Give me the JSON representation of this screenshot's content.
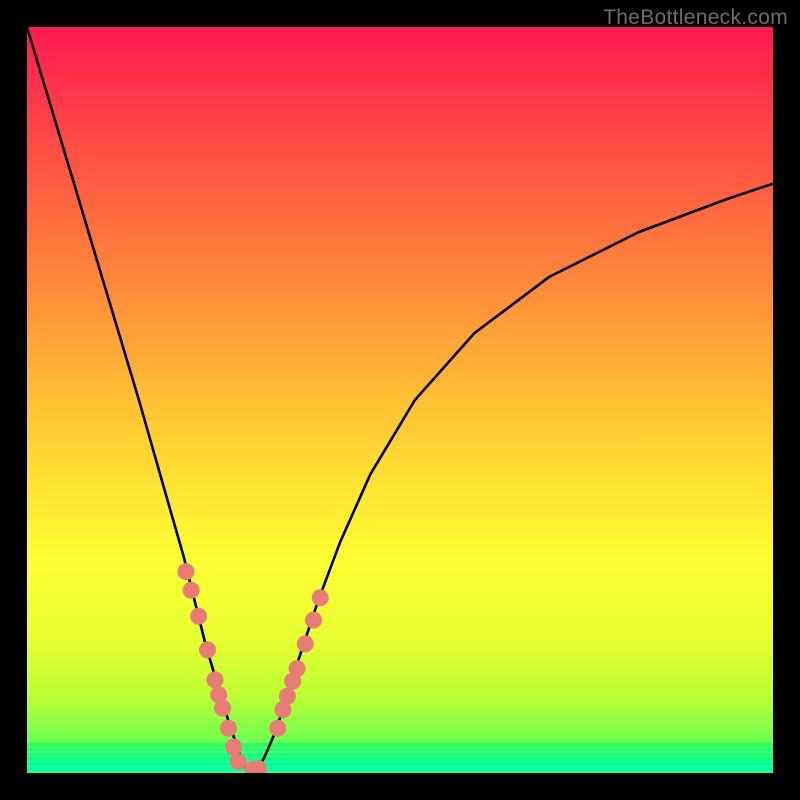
{
  "watermark": "TheBottleneck.com",
  "chart_data": {
    "type": "line",
    "title": "",
    "xlabel": "",
    "ylabel": "",
    "xlim": [
      0,
      100
    ],
    "ylim": [
      0,
      100
    ],
    "series": [
      {
        "name": "curve",
        "x": [
          0,
          3,
          6,
          9,
          12,
          15,
          17,
          19,
          21,
          22.5,
          24,
          25.5,
          27,
          28,
          29,
          30,
          31,
          32,
          33.5,
          35,
          37,
          39,
          42,
          46,
          52,
          60,
          70,
          82,
          94,
          100
        ],
        "y": [
          100,
          90,
          80,
          70,
          60,
          50,
          43,
          36,
          29,
          23,
          17,
          12,
          7,
          4,
          1,
          0,
          0.5,
          2.5,
          6,
          11,
          17,
          23,
          31,
          40,
          50,
          59,
          66.5,
          72.5,
          77,
          79
        ]
      },
      {
        "name": "markers-left",
        "x": [
          21.3,
          22.0,
          23.0,
          24.2,
          25.2,
          25.7,
          26.2,
          27.0,
          27.7,
          28.3,
          30.3,
          31.0
        ],
        "y": [
          27.0,
          24.5,
          21.0,
          16.5,
          12.5,
          10.5,
          8.7,
          6.0,
          3.5,
          1.5,
          0.5,
          0.6
        ]
      },
      {
        "name": "markers-right",
        "x": [
          33.6,
          34.3,
          34.9,
          35.6,
          36.2,
          37.3,
          38.4,
          39.3
        ],
        "y": [
          6.0,
          8.5,
          10.3,
          12.3,
          14.0,
          17.3,
          20.5,
          23.5
        ]
      }
    ],
    "green_bands": [
      {
        "y": 3.5,
        "h": 0.45,
        "c": "#26ff6a"
      },
      {
        "y": 2.9,
        "h": 0.45,
        "c": "#1cff78"
      },
      {
        "y": 2.3,
        "h": 0.45,
        "c": "#12ff86"
      },
      {
        "y": 1.7,
        "h": 0.45,
        "c": "#08ff94"
      },
      {
        "y": 1.1,
        "h": 0.45,
        "c": "#00ffa2"
      },
      {
        "y": 0.5,
        "h": 0.6,
        "c": "#00ffb4"
      }
    ],
    "marker_color": "#e77b76",
    "curve_color": "#000000"
  }
}
